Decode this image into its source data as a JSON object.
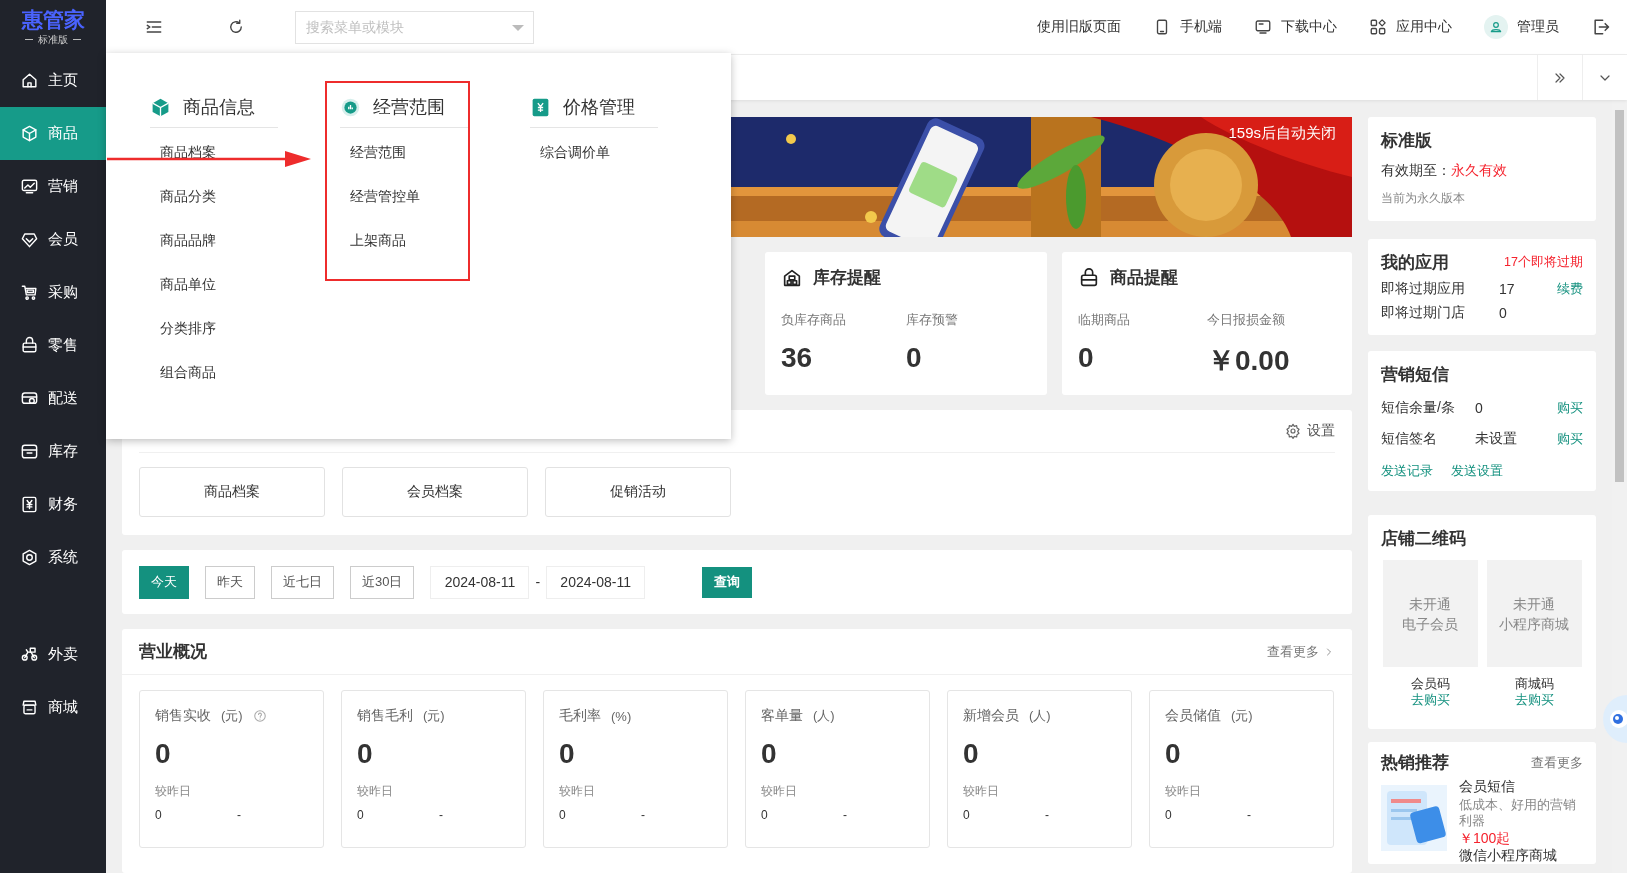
{
  "logo": {
    "title": "惠管家",
    "subtitle": "标准版"
  },
  "sidebar": {
    "groups": [
      {
        "items": [
          {
            "label": "主页",
            "selected": false
          },
          {
            "label": "商品",
            "selected": true
          },
          {
            "label": "营销",
            "selected": false
          },
          {
            "label": "会员",
            "selected": false
          },
          {
            "label": "采购",
            "selected": false
          },
          {
            "label": "零售",
            "selected": false
          },
          {
            "label": "配送",
            "selected": false
          },
          {
            "label": "库存",
            "selected": false
          },
          {
            "label": "财务",
            "selected": false
          },
          {
            "label": "系统",
            "selected": false
          }
        ]
      },
      {
        "items": [
          {
            "label": "外卖",
            "selected": false
          },
          {
            "label": "商城",
            "selected": false
          }
        ]
      }
    ]
  },
  "topbar": {
    "search": {
      "placeholder": "搜索菜单或模块"
    },
    "links": [
      "使用旧版页面",
      "手机端",
      "下载中心",
      "应用中心",
      "管理员"
    ]
  },
  "menu": {
    "columns": [
      {
        "title": "商品信息",
        "highlighted": false,
        "items": [
          "商品档案",
          "商品分类",
          "商品品牌",
          "商品单位",
          "分类排序",
          "组合商品"
        ]
      },
      {
        "title": "经营范围",
        "highlighted": true,
        "items": [
          "经营范围",
          "经营管控单",
          "上架商品"
        ]
      },
      {
        "title": "价格管理",
        "highlighted": false,
        "items": [
          "综合调价单"
        ]
      }
    ]
  },
  "banner": {
    "kind": "picture",
    "countdown": "159s后自动关闭"
  },
  "reminders": [
    {
      "title": "库存提醒",
      "stats": [
        {
          "label": "负库存商品",
          "value": "36"
        },
        {
          "label": "库存预警",
          "value": "0"
        }
      ]
    },
    {
      "title": "商品提醒",
      "stats": [
        {
          "label": "临期商品",
          "value": "0"
        },
        {
          "label": "今日报损金额",
          "value": "￥0.00"
        }
      ]
    }
  ],
  "shortcuts": {
    "settings": "设置",
    "buttons": [
      "商品档案",
      "会员档案",
      "促销活动"
    ]
  },
  "filter": {
    "ranges": [
      {
        "label": "今天",
        "selected": true
      },
      {
        "label": "昨天",
        "selected": false
      },
      {
        "label": "近七日",
        "selected": false
      },
      {
        "label": "近30日",
        "selected": false
      }
    ],
    "start": "2024-08-11",
    "separator": "-",
    "end": "2024-08-11",
    "query": "查询"
  },
  "overview": {
    "title": "营业概况",
    "more": "查看更多",
    "metrics": [
      {
        "label": "销售实收",
        "unit": "(元)",
        "help": true,
        "value": "0",
        "compare_label": "较昨日",
        "compare_value": "0",
        "change": "-"
      },
      {
        "label": "销售毛利",
        "unit": "(元)",
        "help": false,
        "value": "0",
        "compare_label": "较昨日",
        "compare_value": "0",
        "change": "-"
      },
      {
        "label": "毛利率",
        "unit": "(%)",
        "help": false,
        "value": "0",
        "compare_label": "较昨日",
        "compare_value": "0",
        "change": "-"
      },
      {
        "label": "客单量",
        "unit": "(人)",
        "help": false,
        "value": "0",
        "compare_label": "较昨日",
        "compare_value": "0",
        "change": "-"
      },
      {
        "label": "新增会员",
        "unit": "(人)",
        "help": false,
        "value": "0",
        "compare_label": "较昨日",
        "compare_value": "0",
        "change": "-"
      },
      {
        "label": "会员储值",
        "unit": "(元)",
        "help": false,
        "value": "0",
        "compare_label": "较昨日",
        "compare_value": "0",
        "change": "-"
      }
    ]
  },
  "edition": {
    "title": "标准版",
    "validity_label": "有效期至：",
    "validity": "永久有效",
    "note": "当前为永久版本"
  },
  "apps": {
    "title": "我的应用",
    "alert": "17个即将过期",
    "rows": [
      {
        "label": "即将过期应用",
        "value": "17",
        "action": "续费"
      },
      {
        "label": "即将过期门店",
        "value": "0"
      }
    ]
  },
  "sms": {
    "title": "营销短信",
    "rows": [
      {
        "label": "短信余量/条",
        "value": "0",
        "action": "购买"
      },
      {
        "label": "短信签名",
        "value": "未设置",
        "action": "购买"
      }
    ],
    "links": [
      "发送记录",
      "发送设置"
    ]
  },
  "qrcodes": {
    "title": "店铺二维码",
    "items": [
      {
        "status": "未开通",
        "name": "电子会员",
        "label": "会员码",
        "action": "去购买"
      },
      {
        "status": "未开通",
        "name": "小程序商城",
        "label": "商城码",
        "action": "去购买"
      }
    ]
  },
  "hot": {
    "title": "热销推荐",
    "more": "查看更多",
    "items": [
      {
        "kind": "picture",
        "name": "会员短信",
        "desc": "低成本、好用的营销利器",
        "price": "￥100起"
      }
    ],
    "next": "微信小程序商城"
  }
}
